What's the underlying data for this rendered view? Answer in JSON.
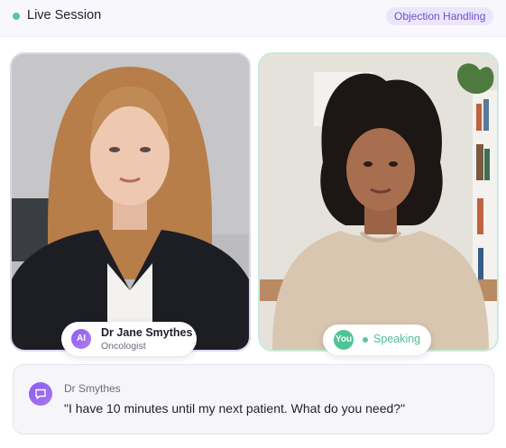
{
  "header": {
    "title": "Live Session",
    "mode_badge": "Objection Handling"
  },
  "ai_participant": {
    "avatar_initials": "AI",
    "name": "Dr Jane Smythes",
    "role": "Oncologist"
  },
  "user_participant": {
    "avatar_label": "You",
    "status": "Speaking"
  },
  "transcript": {
    "speaker": "Dr Smythes",
    "message": "\"I have 10 minutes until my next patient. What do you need?\""
  },
  "colors": {
    "live_indicator": "#58c79a",
    "badge_text": "#6b4fd0",
    "badge_bg": "#ece6fb",
    "ai_accent": "#8b5cf6",
    "speaking_green": "#4fc496"
  }
}
